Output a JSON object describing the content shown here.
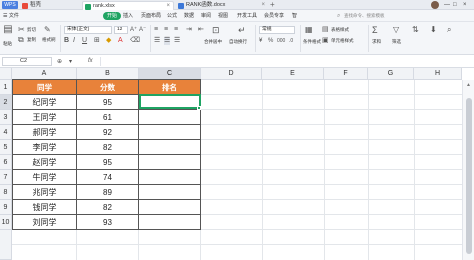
{
  "titlebar": {
    "app_logo": "WPS",
    "tabs": [
      {
        "label": "稻壳",
        "icon": "daoke-icon"
      },
      {
        "label": "rank.xlsx",
        "icon": "spreadsheet-icon"
      },
      {
        "label": "RANK函数.docx",
        "icon": "word-doc-icon"
      }
    ],
    "close_glyph": "×",
    "new_tab_glyph": "+",
    "window_controls": [
      "—",
      "□",
      "×"
    ]
  },
  "menubar": {
    "file": "☰ 文件",
    "items": [
      "开始",
      "插入",
      "页面布局",
      "公式",
      "数据",
      "审阅",
      "视图",
      "开发工具",
      "会员专享",
      "智"
    ],
    "active": "开始",
    "search_placeholder": "查找命令、搜索模板"
  },
  "ribbon": {
    "paste": "粘贴",
    "cut": "剪切",
    "copy": "复制",
    "format_painter": "格式刷",
    "font_name": "宋体(正文)",
    "font_size": "12",
    "merge_center": "合并居中",
    "auto_wrap": "自动换行",
    "number_format": "常规",
    "cond_format": "条件格式",
    "table_style": "表格样式",
    "cell_style": "单元格样式",
    "sum": "求和",
    "filter": "筛选"
  },
  "formula_bar": {
    "name_box": "C2",
    "fx": "fx",
    "value": ""
  },
  "grid": {
    "columns": [
      "A",
      "B",
      "C",
      "D",
      "E",
      "F",
      "G",
      "H"
    ],
    "selected_column": "C",
    "rows": [
      "1",
      "2",
      "3",
      "4",
      "5",
      "6",
      "7",
      "8",
      "9",
      "10"
    ],
    "selected_row": "2",
    "selected_cell": "C2"
  },
  "table": {
    "headers": [
      "同学",
      "分数",
      "排名"
    ],
    "rows": [
      [
        "纪同学",
        "95",
        ""
      ],
      [
        "王同学",
        "61",
        ""
      ],
      [
        "郝同学",
        "92",
        ""
      ],
      [
        "李同学",
        "82",
        ""
      ],
      [
        "赵同学",
        "95",
        ""
      ],
      [
        "牛同学",
        "74",
        ""
      ],
      [
        "兆同学",
        "89",
        ""
      ],
      [
        "钱同学",
        "82",
        ""
      ],
      [
        "刘同学",
        "93",
        ""
      ]
    ]
  },
  "colors": {
    "header_fill": "#e8823a",
    "accent": "#1fa463"
  }
}
